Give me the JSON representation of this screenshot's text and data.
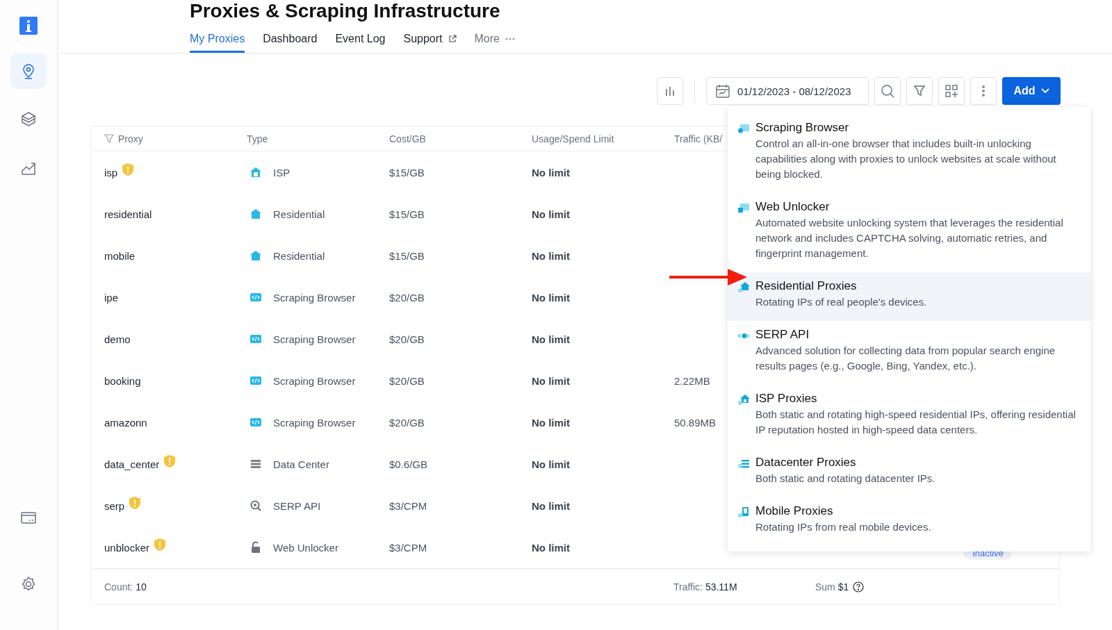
{
  "title": "Proxies & Scraping Infrastructure",
  "sidebar": {
    "top": [
      {
        "kind": "pin",
        "selected": true
      },
      {
        "kind": "layers",
        "selected": false
      },
      {
        "kind": "chart",
        "selected": false
      }
    ],
    "bottom": [
      {
        "kind": "card",
        "selected": false
      },
      {
        "kind": "settings",
        "selected": false
      }
    ]
  },
  "tabs": [
    {
      "kind": "plain",
      "label": "My Proxies",
      "selected": true
    },
    {
      "kind": "plain",
      "label": "Dashboard",
      "selected": false
    },
    {
      "kind": "plain",
      "label": "Event Log",
      "selected": false
    },
    {
      "kind": "external",
      "label": "Support",
      "selected": false
    },
    {
      "kind": "more",
      "label": "More",
      "selected": false
    }
  ],
  "toolbar": {
    "date_range": "01/12/2023 - 08/12/2023",
    "add_button": "Add"
  },
  "table": {
    "columns": [
      "Proxy",
      "Type",
      "Cost/GB",
      "Usage/Spend Limit",
      "Traffic (KB/"
    ],
    "rows": [
      {
        "proxy": "isp",
        "warning": true,
        "kind": "isp",
        "type": "ISP",
        "cost": "$15/GB",
        "limit": "No limit"
      },
      {
        "proxy": "residential",
        "warning": false,
        "kind": "residential",
        "type": "Residential",
        "cost": "$15/GB",
        "limit": "No limit"
      },
      {
        "proxy": "mobile",
        "warning": false,
        "kind": "residential",
        "type": "Residential",
        "cost": "$15/GB",
        "limit": "No limit"
      },
      {
        "proxy": "ipe",
        "warning": false,
        "kind": "browser",
        "type": "Scraping Browser",
        "cost": "$20/GB",
        "limit": "No limit"
      },
      {
        "proxy": "demo",
        "warning": false,
        "kind": "browser",
        "type": "Scraping Browser",
        "cost": "$20/GB",
        "limit": "No limit"
      },
      {
        "proxy": "booking",
        "warning": false,
        "kind": "browser",
        "type": "Scraping Browser",
        "cost": "$20/GB",
        "limit": "No limit",
        "traffic": "2.22MB"
      },
      {
        "proxy": "amazonn",
        "warning": false,
        "kind": "browser",
        "type": "Scraping Browser",
        "cost": "$20/GB",
        "limit": "No limit",
        "traffic": "50.89MB"
      },
      {
        "proxy": "data_center",
        "warning": true,
        "kind": "datacenter",
        "type": "Data Center",
        "cost": "$0.6/GB",
        "limit": "No limit"
      },
      {
        "proxy": "serp",
        "warning": true,
        "kind": "serp",
        "type": "SERP API",
        "cost": "$3/CPM",
        "limit": "No limit"
      },
      {
        "proxy": "unblocker",
        "warning": true,
        "kind": "unlocker",
        "type": "Web Unlocker",
        "cost": "$3/CPM",
        "limit": "No limit",
        "status": "Inactive"
      }
    ],
    "footer": {
      "count_label": "Count:",
      "count": "10",
      "traffic_label": "Traffic:",
      "traffic": "53.11M",
      "sum_label": "Sum",
      "sum": "$1"
    }
  },
  "add_menu": [
    {
      "kind": "browser",
      "title": "Scraping Browser",
      "description": "Control an all-in-one browser that includes built-in unlocking capabilities along with proxies to unlock websites at scale without being blocked.",
      "highlighted": false
    },
    {
      "kind": "unlocker",
      "title": "Web Unlocker",
      "description": "Automated website unlocking system that leverages the residential network and includes CAPTCHA solving, automatic retries, and fingerprint management.",
      "highlighted": false
    },
    {
      "kind": "residential",
      "title": "Residential Proxies",
      "description": "Rotating IPs of real people's devices.",
      "highlighted": true
    },
    {
      "kind": "serp",
      "title": "SERP API",
      "description": "Advanced solution for collecting data from popular search engine results pages (e.g., Google, Bing, Yandex, etc.).",
      "highlighted": false
    },
    {
      "kind": "isp",
      "title": "ISP Proxies",
      "description": "Both static and rotating high-speed residential IPs, offering residential IP reputation hosted in high-speed data centers.",
      "highlighted": false
    },
    {
      "kind": "datacenter",
      "title": "Datacenter Proxies",
      "description": "Both static and rotating datacenter IPs.",
      "highlighted": false
    },
    {
      "kind": "mobile",
      "title": "Mobile Proxies",
      "description": "Rotating IPs from real mobile devices.",
      "highlighted": false
    }
  ]
}
